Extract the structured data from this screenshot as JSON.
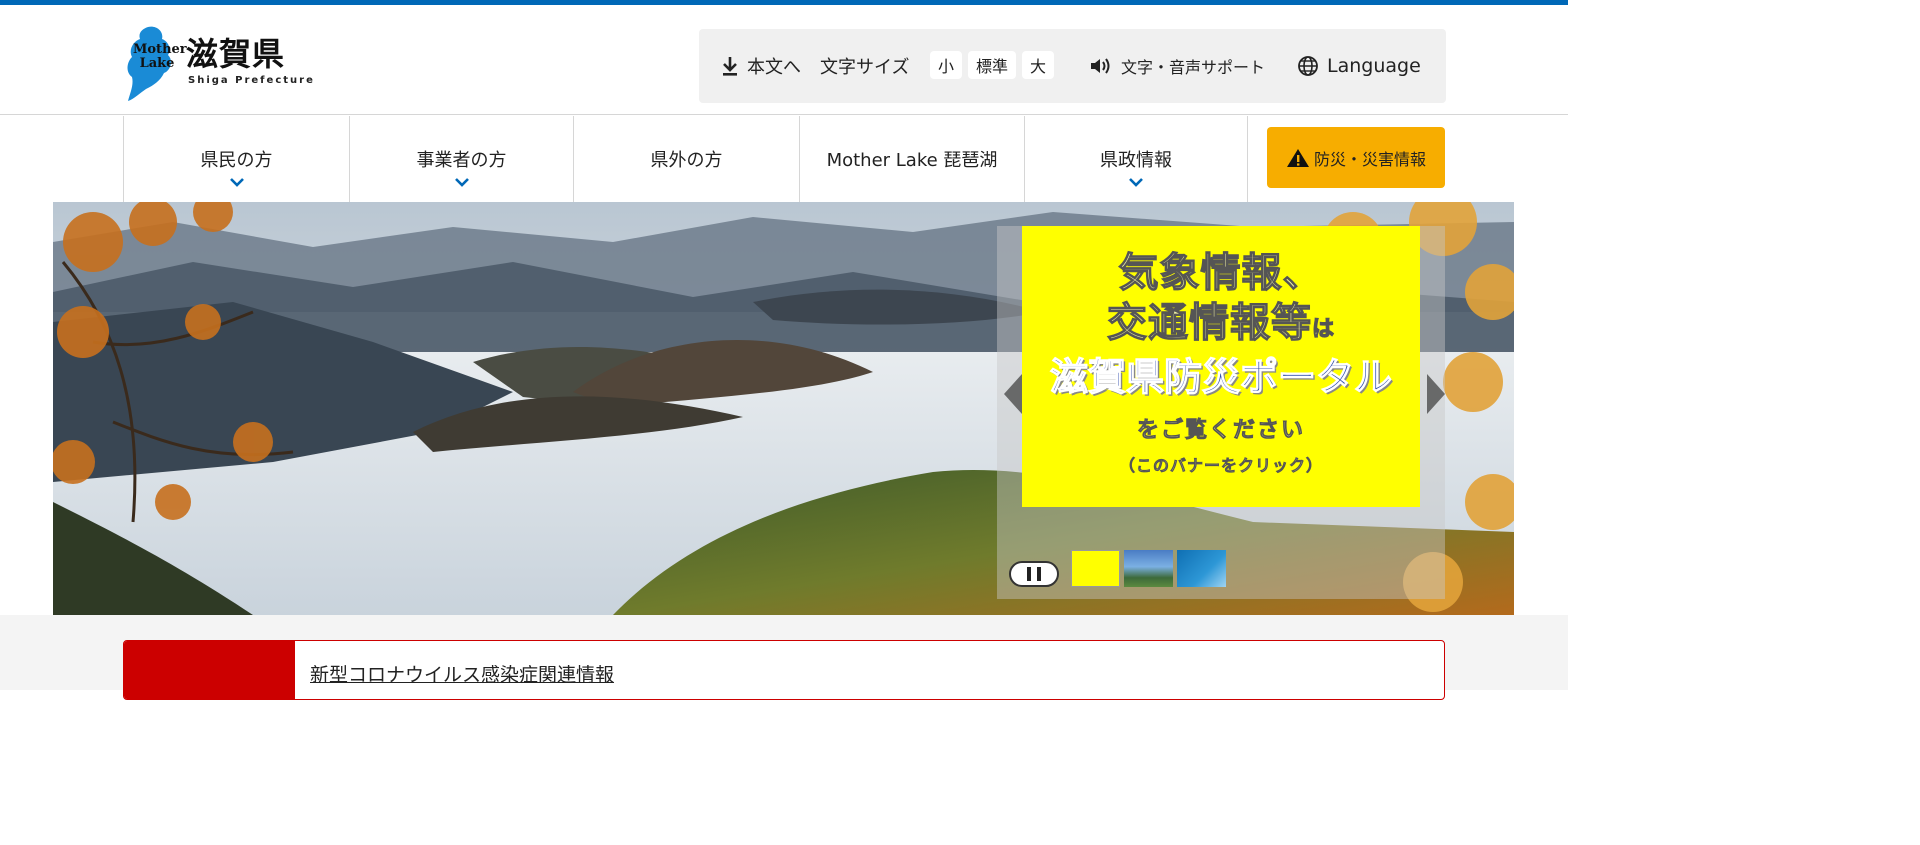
{
  "header": {
    "logo_mother_lake": "Mother Lake",
    "logo_title": "滋賀県",
    "logo_subtitle": "Shiga Prefecture",
    "utility": {
      "skip_to_content": "本文へ",
      "font_size_label": "文字サイズ",
      "font_size_small": "小",
      "font_size_standard": "標準",
      "font_size_large": "大",
      "voice_support": "文字・音声サポート",
      "language": "Language"
    }
  },
  "nav": {
    "items": [
      {
        "label": "県民の方"
      },
      {
        "label": "事業者の方"
      },
      {
        "label": "県外の方"
      },
      {
        "label": "Mother Lake 琵琶湖"
      },
      {
        "label": "県政情報"
      }
    ],
    "disaster_button": "防災・災害情報"
  },
  "hero": {
    "banner": {
      "line1": "気象情報、",
      "line2": "交通情報等",
      "line2_suffix": "は",
      "line3": "滋賀県防災ポータル",
      "line4": "をご覧ください",
      "line5": "（このバナーをクリック）"
    }
  },
  "notice": {
    "link": "新型コロナウイルス感染症関連情報"
  },
  "colors": {
    "brand_blue": "#0068b7",
    "disaster_orange": "#f7ad00",
    "banner_yellow": "#ffff00",
    "notice_red": "#cc0000"
  }
}
